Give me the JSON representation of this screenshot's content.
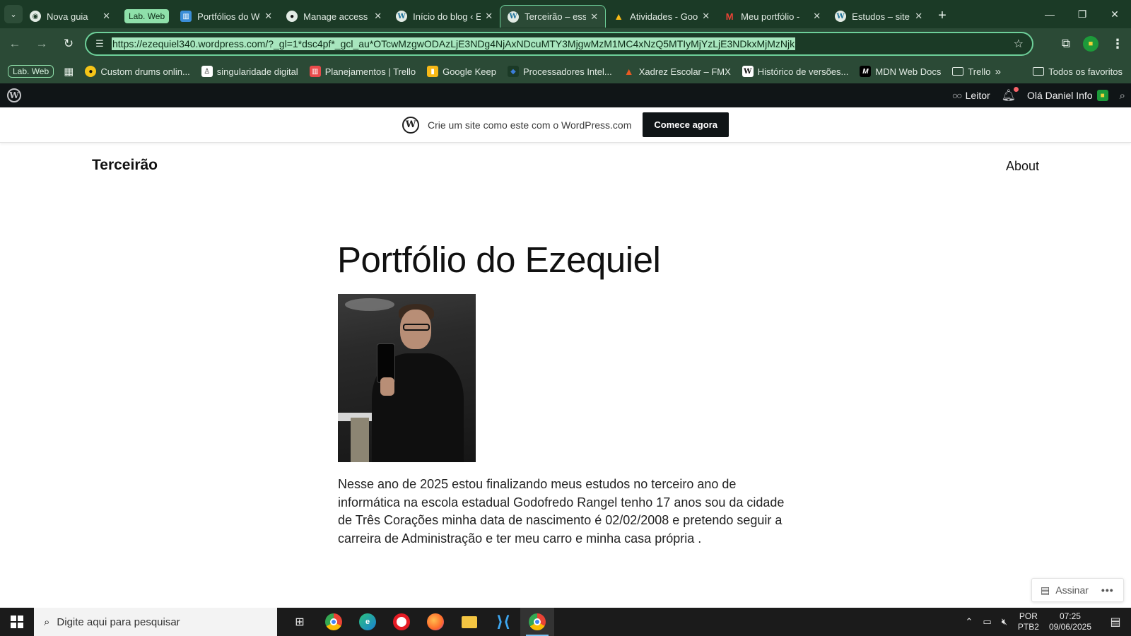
{
  "browser": {
    "tab_group_label": "Lab. Web",
    "tabs": [
      {
        "title": "Nova guia",
        "icon": "chrome-icon"
      },
      {
        "title": "Portfólios do Wo",
        "icon": "trello-icon"
      },
      {
        "title": "Manage access",
        "icon": "github-icon"
      },
      {
        "title": "Início do blog ‹ E",
        "icon": "wordpress-icon"
      },
      {
        "title": "Terceirão – esse",
        "icon": "wordpress-icon",
        "active": true
      },
      {
        "title": "Atividades - Goo",
        "icon": "drive-icon"
      },
      {
        "title": "Meu portfólio -",
        "icon": "gmail-icon"
      },
      {
        "title": "Estudos – site pa",
        "icon": "wordpress-icon"
      }
    ],
    "url": "https://ezequiel340.wordpress.com/?_gl=1*dsc4pf*_gcl_au*OTcwMzgwODAzLjE3NDg4NjAxNDcuMTY3MjgwMzM1MC4xNzQ5MTIyMjYzLjE3NDkxMjMzNjk",
    "bookmarks_group": "Lab. Web",
    "bookmarks": [
      {
        "label": "Custom drums onlin...",
        "icon": "drum-icon",
        "color": "#f5c518"
      },
      {
        "label": "singularidade digital",
        "icon": "user-icon",
        "color": "#ffffff"
      },
      {
        "label": "Planejamentos | Trello",
        "icon": "trello-icon",
        "color": "#e94b4b"
      },
      {
        "label": "Google Keep",
        "icon": "keep-icon",
        "color": "#f7b917"
      },
      {
        "label": "Processadores Intel...",
        "icon": "intel-icon",
        "color": "#3b7dd8"
      },
      {
        "label": "Xadrez Escolar – FMX",
        "icon": "chess-icon",
        "color": "#e85a22"
      },
      {
        "label": "Histórico de versões...",
        "icon": "wikipedia-icon",
        "color": "#ffffff"
      },
      {
        "label": "MDN Web Docs",
        "icon": "mdn-icon",
        "color": "#000000"
      },
      {
        "label": "Trello",
        "icon": "folder-icon",
        "color": "#e2ebe4"
      }
    ],
    "all_bookmarks": "Todos os favoritos"
  },
  "wp_admin_bar": {
    "reader": "Leitor",
    "greeting": "Olá Daniel Info"
  },
  "banner": {
    "text": "Crie um site como este com o WordPress.com",
    "cta": "Comece agora"
  },
  "site": {
    "title": "Terceirão",
    "nav": [
      "About"
    ]
  },
  "post": {
    "title": "Portfólio do Ezequiel",
    "body": "Nesse ano de 2025 estou finalizando meus estudos no terceiro ano de informática na escola estadual Godofredo Rangel tenho 17 anos sou da cidade de Três Corações minha data de nascimento é 02/02/2008 e pretendo seguir a carreira de Administração e ter meu carro e minha casa própria ."
  },
  "subscribe": {
    "label": "Assinar"
  },
  "taskbar": {
    "search_placeholder": "Digite aqui para pesquisar",
    "lang_top": "POR",
    "lang_bottom": "PTB2",
    "time": "07:25",
    "date": "09/06/2025",
    "apps": [
      "task-view-icon",
      "chrome-icon",
      "edge-icon",
      "opera-icon",
      "firefox-icon",
      "file-explorer-icon",
      "vscode-icon",
      "chrome-profile-icon"
    ]
  },
  "colors": {
    "chrome_frame": "#1b3a26",
    "chrome_toolbar": "#2b4a36",
    "accent": "#6ed09a",
    "wp_bar": "#101517"
  }
}
